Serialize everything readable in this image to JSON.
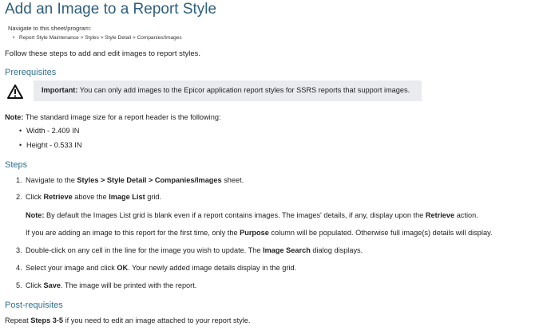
{
  "title": "Add an Image to a Report Style",
  "navigate": {
    "label": "Navigate to this sheet/program:",
    "path": "Report Style Maintenance > Styles > Style Detail > Companies/Images"
  },
  "intro": "Follow these steps to add and edit images to report styles.",
  "prerequisites": {
    "heading": "Prerequisites",
    "important_label": "Important:",
    "important_text": " You can only add images to the Epicor application report styles for SSRS reports that support images.",
    "icon": "warning-triangle-icon"
  },
  "note": {
    "label": "Note:",
    "text": " The standard image size for a report header is the following:",
    "items": [
      "Width - 2.409 IN",
      "Height - 0.533 IN"
    ]
  },
  "steps": {
    "heading": "Steps",
    "s1": {
      "num": "1.",
      "a": "Navigate to the ",
      "b": "Styles > Style Detail > Companies/Images",
      "c": " sheet."
    },
    "s2": {
      "num": "2.",
      "a": "Click ",
      "b": "Retrieve",
      "c": " above the ",
      "d": "Image List",
      "e": " grid."
    },
    "s2_note": {
      "label": "Note:",
      "a": " By default the Images List grid is blank even if a report contains images. The images' details, if any, display upon the ",
      "b": "Retrieve",
      "c": " action."
    },
    "s2_extra": {
      "a": "If you are adding an image to this report for the first time, only the ",
      "b": "Purpose",
      "c": " column will be populated. Otherwise full image(s) details will display."
    },
    "s3": {
      "num": "3.",
      "a": "Double-click on any cell in the line for the image you wish to update. The ",
      "b": "Image Search",
      "c": " dialog displays."
    },
    "s4": {
      "num": "4.",
      "a": "Select your image and click ",
      "b": "OK",
      "c": ". Your newly added image details display in the grid."
    },
    "s5": {
      "num": "5.",
      "a": "Click ",
      "b": "Save",
      "c": ". The image will be printed with the report."
    }
  },
  "post": {
    "heading": "Post-requisites",
    "a": "Repeat ",
    "b": "Steps 3-5",
    "c": " if you need to edit an image attached to your report style."
  }
}
